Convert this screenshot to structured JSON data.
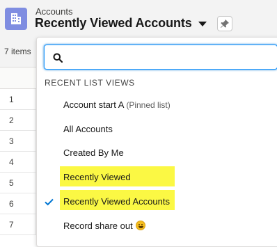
{
  "header": {
    "object_name": "Accounts",
    "view_title": "Recently Viewed Accounts",
    "app_icon": "accounts-building-icon",
    "pin_icon": "pin-icon"
  },
  "list": {
    "item_count": "7 items",
    "row_numbers": [
      "1",
      "2",
      "3",
      "4",
      "5",
      "6",
      "7"
    ]
  },
  "dropdown": {
    "search": {
      "value": "",
      "placeholder": ""
    },
    "section_heading": "RECENT LIST VIEWS",
    "items": [
      {
        "label": "Account start A",
        "suffix": "(Pinned list)"
      },
      {
        "label": "All Accounts"
      },
      {
        "label": "Created By Me"
      },
      {
        "label": "Recently Viewed",
        "highlighted": true
      },
      {
        "label": "Recently Viewed Accounts",
        "highlighted": true,
        "selected": true
      },
      {
        "label": "Record share out",
        "emoji": "grinning-face-icon"
      }
    ]
  },
  "colors": {
    "app_icon_bg": "#7f8de1",
    "highlight": "#fbf844",
    "check": "#0176d3",
    "focus_ring": "#1b96ff"
  }
}
